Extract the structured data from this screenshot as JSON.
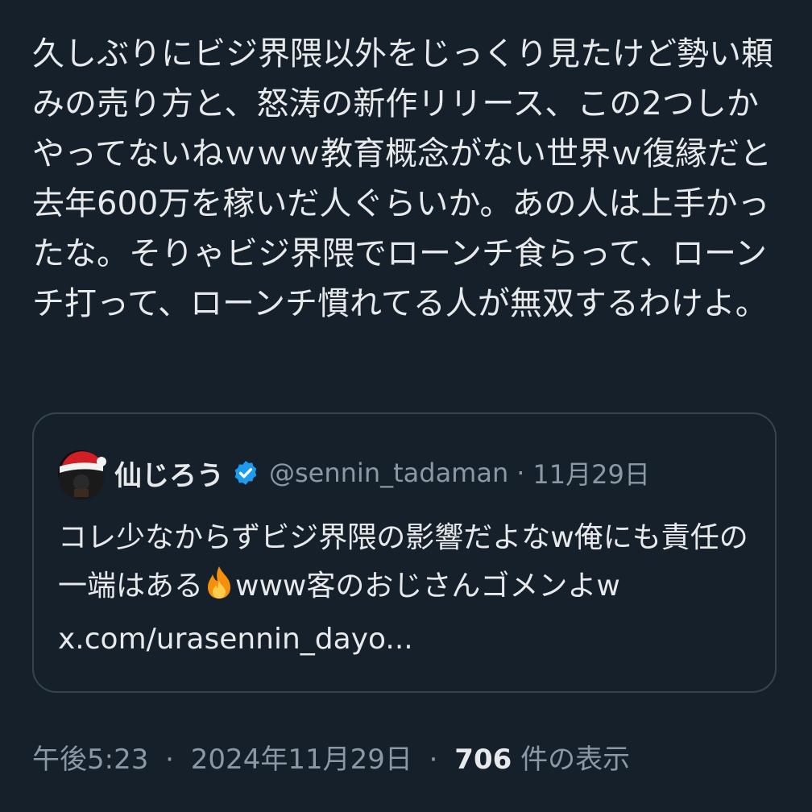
{
  "tweet": {
    "text": "久しぶりにビジ界隈以外をじっくり見たけど勢い頼みの売り方と、怒涛の新作リリース、この2つしかやってないねｗｗｗ教育概念がない世界ｗ復縁だと去年600万を稼いだ人ぐらいか。あの人は上手かったな。そりゃビジ界隈でローンチ食らって、ローンチ打って、ローンチ慣れてる人が無双するわけよ。"
  },
  "quote": {
    "name": "仙じろう",
    "handle": "@sennin_tadaman",
    "separator": "·",
    "date": "11月29日",
    "text_part1": "コレ少なからずビジ界隈の影響だよなw俺にも責任の一端はある",
    "text_part2": "www客のおじさんゴメンよw",
    "link": "x.com/urasennin_dayo...",
    "icons": [
      "santa-hat-avatar",
      "verified-badge-icon",
      "fire-icon"
    ]
  },
  "meta": {
    "time": "午後5:23",
    "separator": "·",
    "date": "2024年11月29日",
    "views_count": "706",
    "views_label": "件の表示"
  },
  "colors": {
    "background": "#15202b",
    "text": "#e7e9ea",
    "muted": "#8b98a5",
    "border": "#38444d",
    "verified": "#1d9bf0"
  }
}
